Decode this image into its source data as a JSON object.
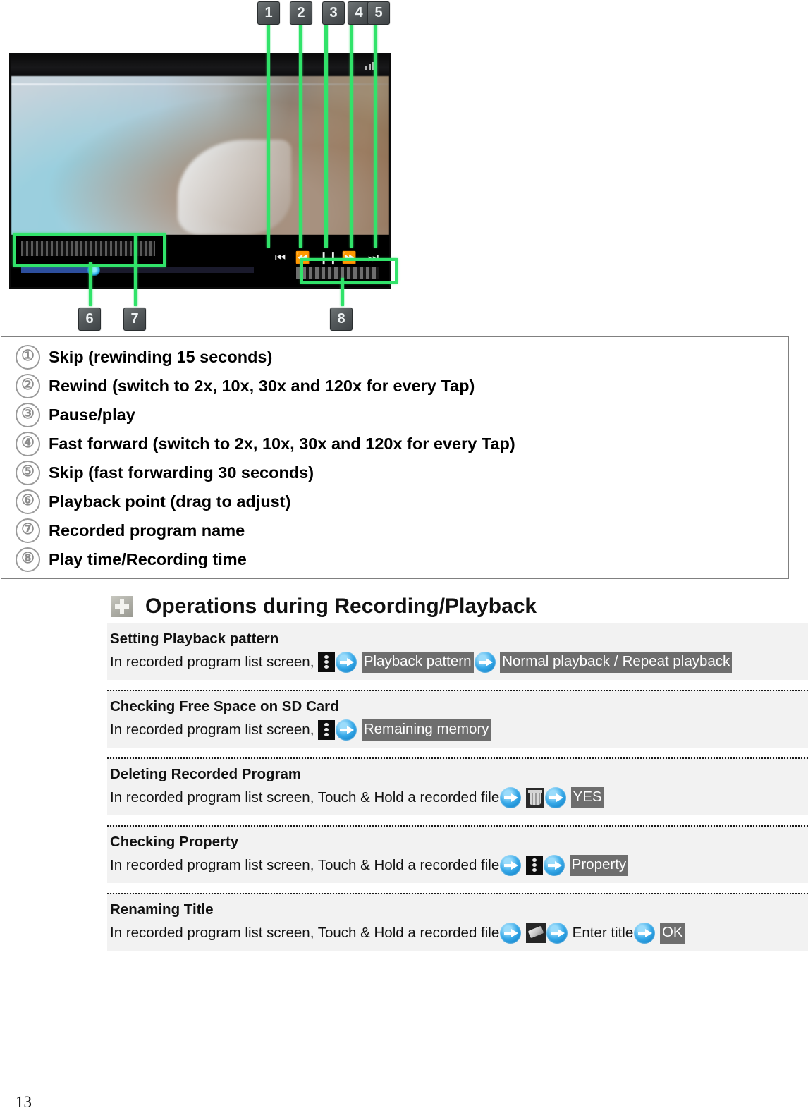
{
  "document": {
    "page_number": "13"
  },
  "figure": {
    "callout_badges_top": [
      "1",
      "2",
      "3",
      "4",
      "5"
    ],
    "callout_badges_bottom": [
      "6",
      "7",
      "8"
    ],
    "player_controls": [
      "skip-back-icon",
      "rewind-icon",
      "pause-icon",
      "fast-forward-icon",
      "skip-forward-icon"
    ]
  },
  "legend": {
    "items": [
      {
        "num": "①",
        "text": "Skip (rewinding 15 seconds)"
      },
      {
        "num": "②",
        "text": "Rewind (switch to 2x, 10x, 30x and 120x for every Tap)"
      },
      {
        "num": "③",
        "text": "Pause/play"
      },
      {
        "num": "④",
        "text": "Fast forward (switch to 2x, 10x, 30x and 120x for every Tap)"
      },
      {
        "num": "⑤",
        "text": "Skip (fast forwarding 30 seconds)"
      },
      {
        "num": "⑥",
        "text": "Playback point (drag to adjust)"
      },
      {
        "num": "⑦",
        "text": "Recorded program name"
      },
      {
        "num": "⑧",
        "text": "Play time/Recording time"
      }
    ]
  },
  "section": {
    "icon": "plus-icon",
    "title": "Operations during Recording/Playback"
  },
  "operations": {
    "rows": [
      {
        "title": "Setting Playback pattern",
        "lead": "In recorded program list screen,",
        "key1": "Playback pattern",
        "key2": "Normal playback",
        "sep": "/",
        "key3": "Repeat playback"
      },
      {
        "title": "Checking Free Space on SD Card",
        "lead": "In recorded program list screen,",
        "key1": "Remaining memory"
      },
      {
        "title": "Deleting Recorded Program",
        "lead": "In recorded program list screen, Touch & Hold a recorded file",
        "key1": "YES"
      },
      {
        "title": "Checking Property",
        "lead": "In recorded program list screen, Touch & Hold a recorded file",
        "key1": "Property"
      },
      {
        "title": "Renaming Title",
        "lead": "In recorded program list screen, Touch & Hold a recorded file",
        "mid": "Enter title",
        "key1": "OK"
      }
    ]
  },
  "colors": {
    "callout_green": "#31e36a",
    "key_background": "#6e6e6e",
    "row_background": "#f2f2f2",
    "arrow_blue": "#38a9e8"
  }
}
